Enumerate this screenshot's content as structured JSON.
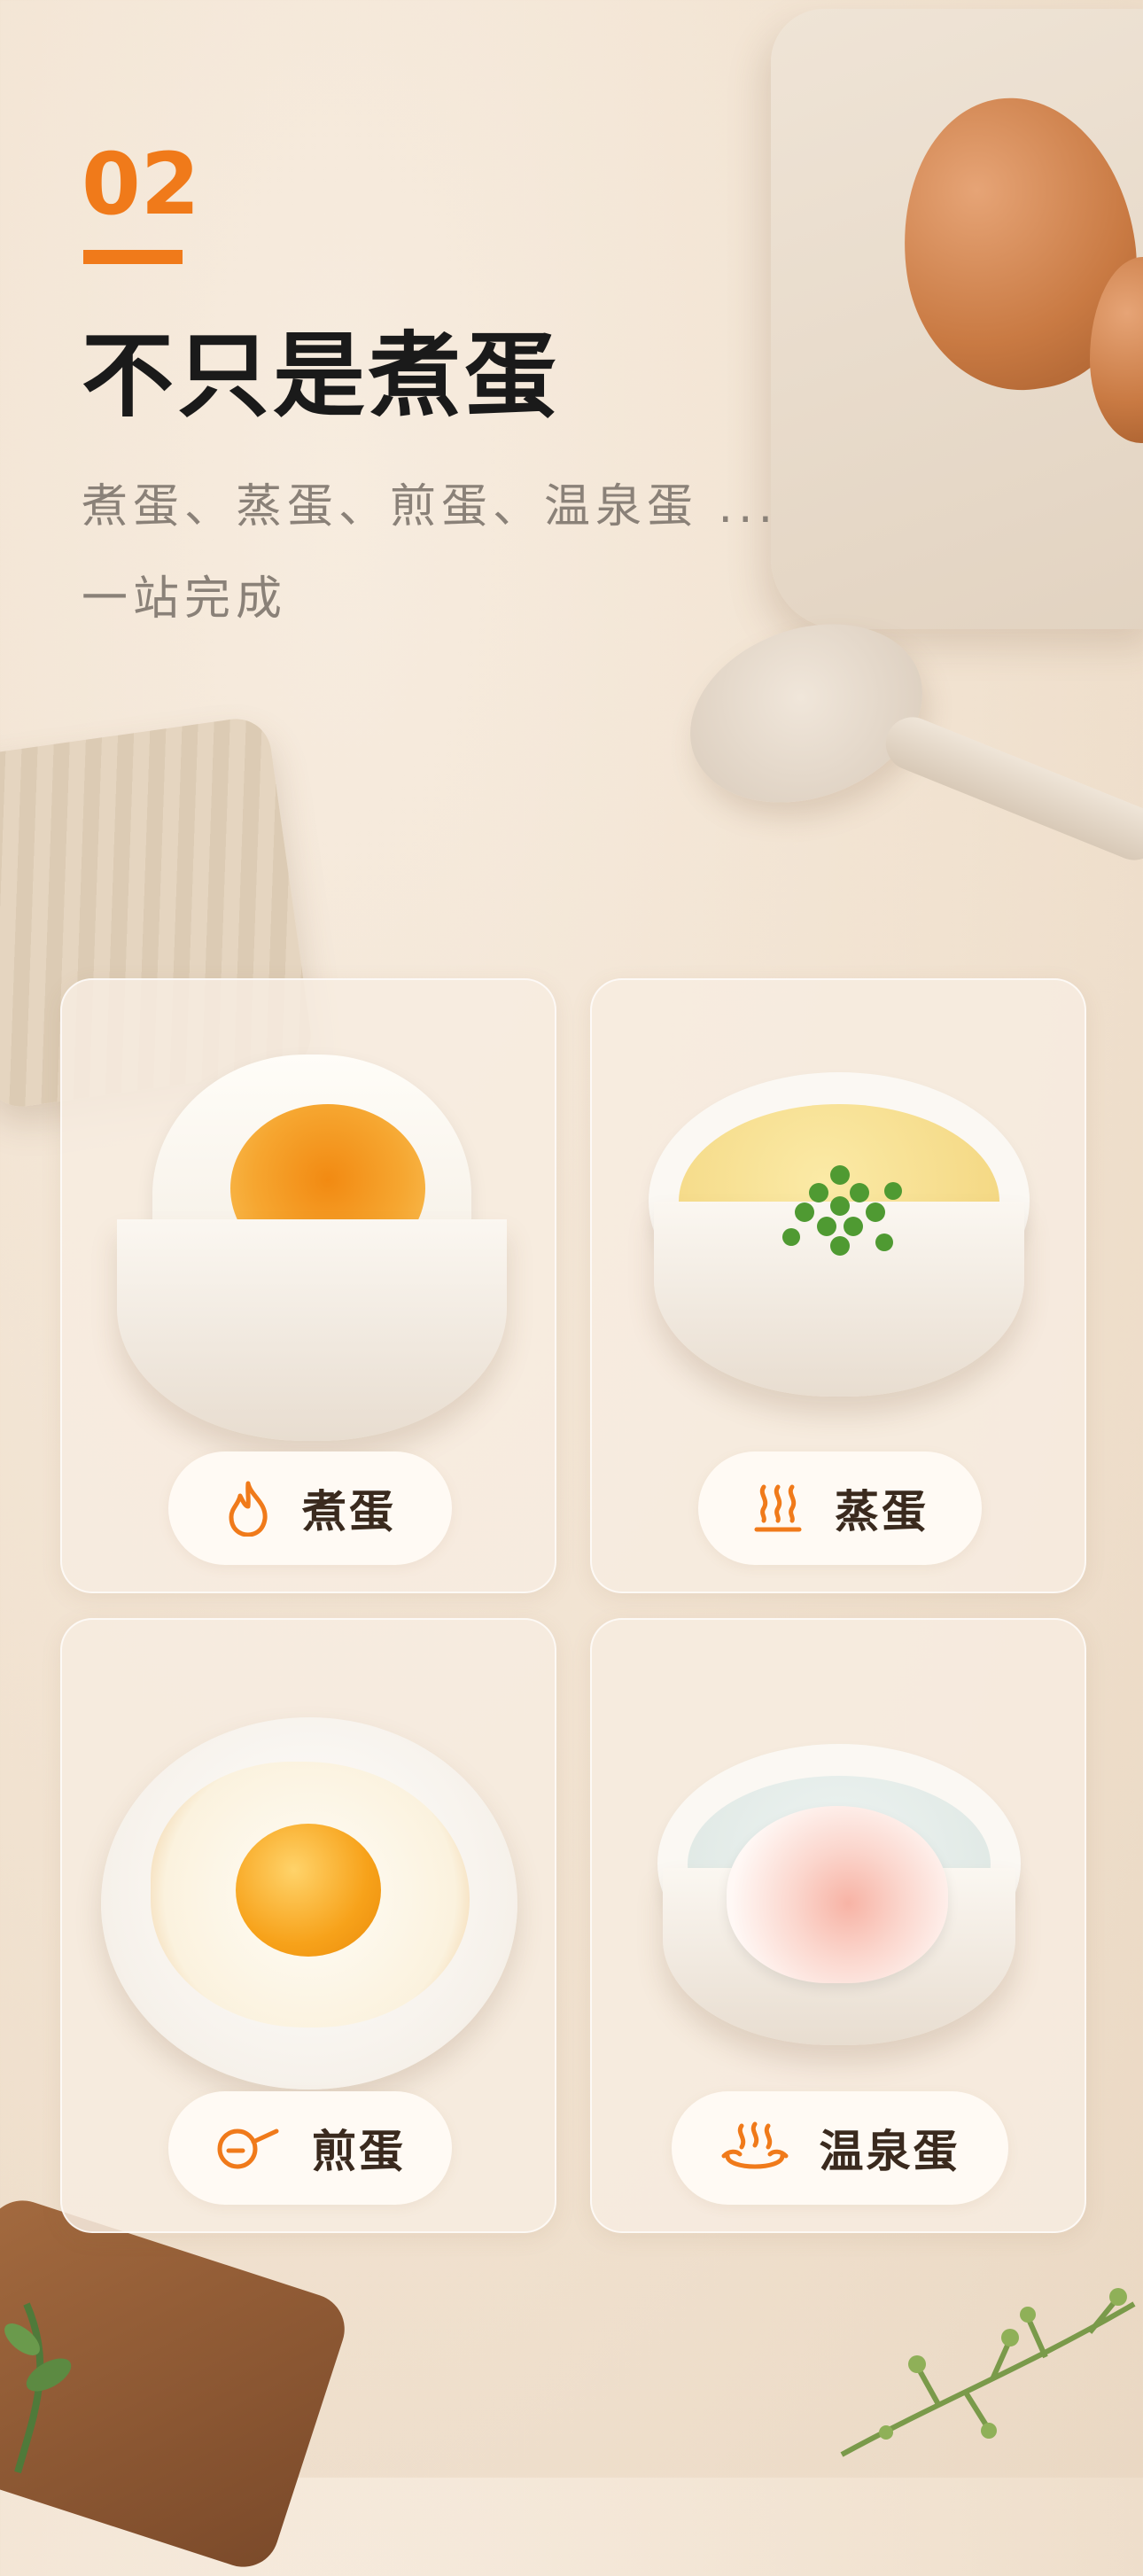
{
  "header": {
    "number": "02",
    "title": "不只是煮蛋",
    "subtitle_line1": "煮蛋、蒸蛋、煎蛋、温泉蛋 ...",
    "subtitle_line2": "一站完成"
  },
  "accent_color": "#f07a1a",
  "cards": [
    {
      "label": "煮蛋",
      "icon": "flame-icon"
    },
    {
      "label": "蒸蛋",
      "icon": "steam-icon"
    },
    {
      "label": "煎蛋",
      "icon": "frying-pan-icon"
    },
    {
      "label": "温泉蛋",
      "icon": "hot-spring-icon"
    }
  ]
}
